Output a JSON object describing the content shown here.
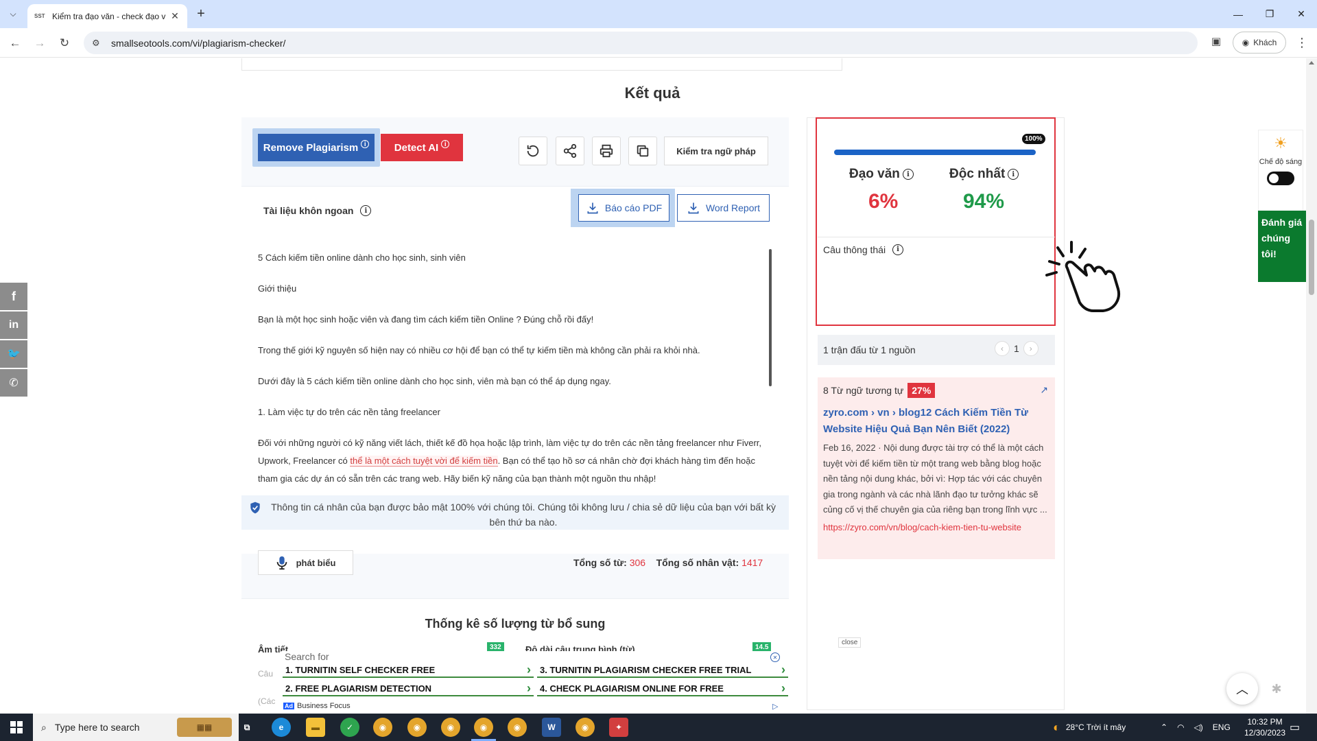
{
  "browser": {
    "tab_title": "Kiểm tra đạo văn - check đạo v",
    "tab_favicon": "SST",
    "url": "smallseotools.com/vi/plagiarism-checker/",
    "profile_label": "Khách"
  },
  "page": {
    "results_title": "Kết quả",
    "actions": {
      "remove_plagiarism": "Remove Plagiarism",
      "detect_ai": "Detect AI",
      "grammar_check": "Kiểm tra ngữ pháp"
    },
    "doc": {
      "label": "Tài liệu khôn ngoan",
      "pdf_report": "Báo cáo PDF",
      "word_report": "Word Report",
      "paragraphs": {
        "p1": "5 Cách kiếm tiền online dành cho học sinh, sinh viên",
        "p2": "Giới thiệu",
        "p3": "Bạn là một học sinh hoặc viên và đang tìm cách kiếm tiền Online ? Đúng chỗ rồi đấy!",
        "p4": "Trong thế giới kỹ nguyên số hiện nay có nhiều cơ hội để bạn có thể tự kiếm tiền mà không cần phải ra khỏi nhà.",
        "p5": "Dưới đây là 5 cách kiếm tiền online dành cho học sinh, viên mà bạn có thể áp dụng ngay.",
        "p6": "1. Làm việc tự do trên các nền tảng freelancer",
        "p7_before": "Đối với những người có kỹ năng viết lách, thiết kế đồ họa hoặc lập trình, làm việc tự do trên các nền tảng freelancer như Fiverr, Upwork, Freelancer có ",
        "p7_highlight": "thể là một cách tuyệt vời để kiếm tiền",
        "p7_after": ". Bạn có thể tạo hồ sơ cá nhân chờ đợi khách hàng tìm đến hoặc tham gia các dự án có sẵn trên các trang web. Hãy biến kỹ năng của bạn thành một nguồn thu nhập!"
      }
    },
    "privacy_notice": "Thông tin cá nhân của bạn được bảo mật 100% với chúng tôi. Chúng tôi không lưu / chia sẻ dữ liệu của bạn với bất kỳ bên thứ ba nào.",
    "speak_label": "phát biểu",
    "totals": {
      "words_label": "Tổng số từ:",
      "words_value": "306",
      "chars_label": "Tổng số nhân vật:",
      "chars_value": "1417"
    },
    "stats": {
      "title": "Thống kê số lượng từ bổ sung",
      "syllables_label": "Âm tiết",
      "syllables_value": "332",
      "avg_sentence_label": "Độ dài câu trung bình (từ)",
      "avg_sentence_value": "14.5",
      "faded_1": "Câu",
      "faded_2": "(Các"
    }
  },
  "result_panel": {
    "progress_label": "100%",
    "progress_fraction": 1.0,
    "plagiarism_label": "Đạo văn",
    "plagiarism_value": "6%",
    "unique_label": "Độc nhất",
    "unique_value": "94%",
    "smart_sentence_label": "Câu thông thái",
    "match_summary": "1 trận đấu từ 1 nguồn",
    "page_number": "1",
    "source": {
      "similar_label": "8 Từ ngữ tương tự",
      "similar_pct": "27%",
      "title": "zyro.com › vn › blog12 Cách Kiếm Tiền Từ Website Hiệu Quả Bạn Nên Biết (2022)",
      "description": "Feb 16, 2022 · Nội dung được tài trợ có thể là một cách tuyệt vời để kiếm tiền từ một trang web bằng blog hoặc nền tảng nội dung khác, bởi vì: Hợp tác với các chuyên gia trong ngành và các nhà lãnh đạo tư tưởng khác sẽ củng cố vị thế chuyên gia của riêng bạn trong lĩnh vực ...",
      "url": "https://zyro.com/vn/blog/cach-kiem-tien-tu-website"
    },
    "close_label": "close"
  },
  "widgets": {
    "theme_label": "Chế độ sáng",
    "rate_label": "Đánh giá chúng tôi!"
  },
  "ads": {
    "search_for": "Search for",
    "items": [
      "1. TURNITIN SELF CHECKER FREE",
      "2. FREE PLAGIARISM DETECTION",
      "3. TURNITIN PLAGIARISM CHECKER FREE TRIAL",
      "4. CHECK PLAGIARISM ONLINE FOR FREE"
    ],
    "brand": "Business Focus",
    "ad_tag": "Ad"
  },
  "taskbar": {
    "search_placeholder": "Type here to search",
    "weather": "28°C  Trời ít mây",
    "language": "ENG",
    "time": "10:32 PM",
    "date": "12/30/2023"
  },
  "colors": {
    "brand_blue": "#2f61b3",
    "danger_red": "#e0343e",
    "unique_green": "#1f9a4a",
    "rate_green": "#0b7a2e"
  }
}
